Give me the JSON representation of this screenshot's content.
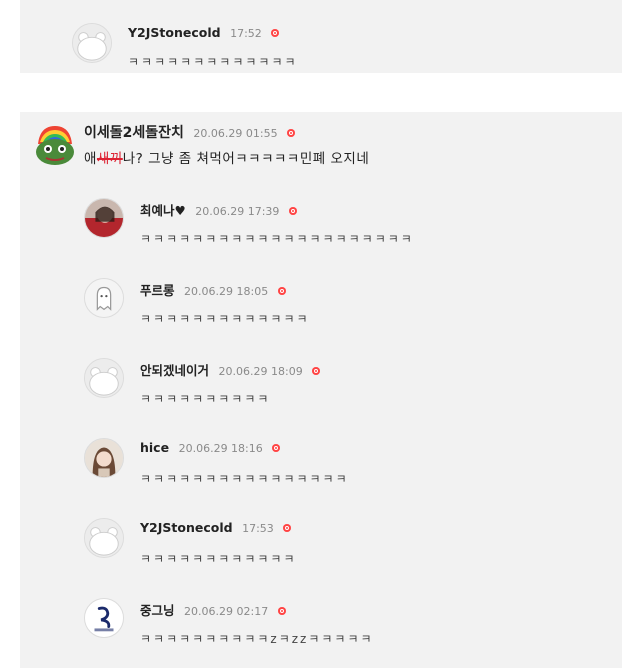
{
  "top_reply": {
    "author": "Y2JStonecold",
    "time": "17:52",
    "text": "ㅋㅋㅋㅋㅋㅋㅋㅋㅋㅋㅋㅋㅋ"
  },
  "main_comment": {
    "author": "이세돌2세돌잔치",
    "time": "20.06.29 01:55",
    "text_before": "애",
    "text_censored": "새끼",
    "text_after": "나? 그냥 좀 쳐먹어ㅋㅋㅋㅋㅋ민폐 오지네"
  },
  "replies": [
    {
      "author": "최예나♥",
      "time": "20.06.29 17:39",
      "text": "ㅋㅋㅋㅋㅋㅋㅋㅋㅋㅋㅋㅋㅋㅋㅋㅋㅋㅋㅋㅋㅋ",
      "avatar": "photo-red-icon"
    },
    {
      "author": "푸르롱",
      "time": "20.06.29 18:05",
      "text": "ㅋㅋㅋㅋㅋㅋㅋㅋㅋㅋㅋㅋㅋ",
      "avatar": "ghost-icon"
    },
    {
      "author": "안되겠네이거",
      "time": "20.06.29 18:09",
      "text": "ㅋㅋㅋㅋㅋㅋㅋㅋㅋㅋ",
      "avatar": "default-bear-icon"
    },
    {
      "author": "hice",
      "time": "20.06.29 18:16",
      "text": "ㅋㅋㅋㅋㅋㅋㅋㅋㅋㅋㅋㅋㅋㅋㅋㅋ",
      "avatar": "photo-portrait-icon"
    },
    {
      "author": "Y2JStonecold",
      "time": "17:53",
      "text": "ㅋㅋㅋㅋㅋㅋㅋㅋㅋㅋㅋㅋ",
      "avatar": "default-bear-icon"
    },
    {
      "author": "중그닝",
      "time": "20.06.29 02:17",
      "text": "ㅋㅋㅋㅋㅋㅋㅋㅋㅋㅋzㅋzzㅋㅋㅋㅋㅋ",
      "avatar": "logo-icon"
    }
  ],
  "colors": {
    "badge": "#ff4444",
    "background": "#f2f2f2",
    "censor": "#dd2233"
  }
}
